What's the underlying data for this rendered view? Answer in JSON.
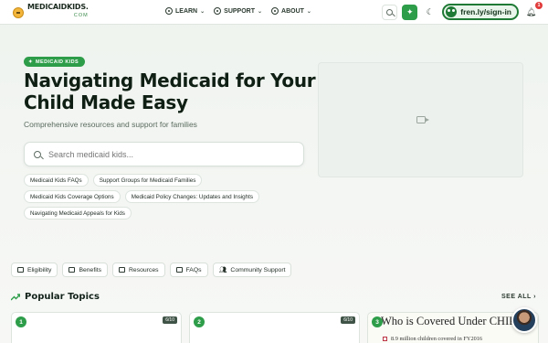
{
  "header": {
    "logo_name": "MEDICAIDKIDS.",
    "logo_tld": "COM",
    "nav": [
      {
        "label": "LEARN",
        "icon": "compass-icon"
      },
      {
        "label": "SUPPORT",
        "icon": "lifebuoy-icon"
      },
      {
        "label": "ABOUT",
        "icon": "help-circle-icon"
      }
    ],
    "signin_label": "fren.ly/sign-in",
    "notification_count": "1"
  },
  "hero": {
    "badge": "MEDICAID KIDS",
    "title": "Navigating Medicaid for Your Child Made Easy",
    "subtitle": "Comprehensive resources and support for families",
    "search_placeholder": "Search medicaid kids...",
    "chips": [
      "Medicaid Kids FAQs",
      "Support Groups for Medicaid Families",
      "Medicaid Kids Coverage Options",
      "Medicaid Policy Changes: Updates and Insights",
      "Navigating Medicaid Appeals for Kids"
    ]
  },
  "categories": [
    {
      "label": "Eligibility",
      "icon": "card-icon"
    },
    {
      "label": "Benefits",
      "icon": "card-icon"
    },
    {
      "label": "Resources",
      "icon": "book-icon"
    },
    {
      "label": "FAQs",
      "icon": "book-icon"
    },
    {
      "label": "Community Support",
      "icon": "users-icon"
    }
  ],
  "popular": {
    "title": "Popular Topics",
    "see_all": "SEE ALL",
    "cards": [
      {
        "num": "1",
        "score": "6/10"
      },
      {
        "num": "2",
        "score": "6/10"
      },
      {
        "num": "3",
        "title": "Who is Covered Under CHIP?",
        "line": "8.9 million children covered in FY2016"
      }
    ]
  },
  "colors": {
    "accent": "#2e9d4a",
    "dark_accent": "#1f7a36",
    "badge_red": "#e23b3b"
  }
}
